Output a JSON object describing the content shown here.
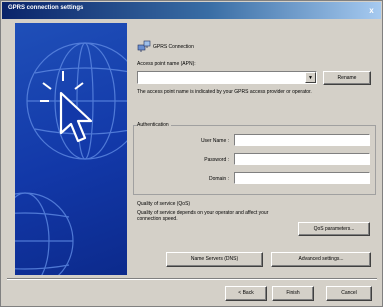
{
  "window": {
    "title": "GPRS connection settings",
    "close_symbol": "x"
  },
  "connection": {
    "icon": "network-connection-icon",
    "label": "GPRS Connection"
  },
  "apn": {
    "label": "Access point name (APN):",
    "value": "",
    "rename_label": "Rename",
    "description": "The access point name is indicated by your GPRS access provider or operator."
  },
  "authentication": {
    "title": "Authentication",
    "user_name_label": "User Name :",
    "user_name_value": "",
    "password_label": "Password :",
    "password_value": "",
    "domain_label": "Domain :",
    "domain_value": ""
  },
  "qos": {
    "title": "Quality of service (QoS)",
    "description": "Quality of service depends on your operator and affect your connection speed.",
    "button_label": "QoS parameters..."
  },
  "extra_buttons": {
    "name_servers": "Name Servers (DNS)",
    "advanced": "Advanced settings..."
  },
  "footer": {
    "back": "< Back",
    "finish": "Finish",
    "cancel": "Cancel"
  },
  "colors": {
    "panel_blue": "#1238a8",
    "title_start": "#0a246a",
    "dialog_bg": "#d4d0c8"
  }
}
